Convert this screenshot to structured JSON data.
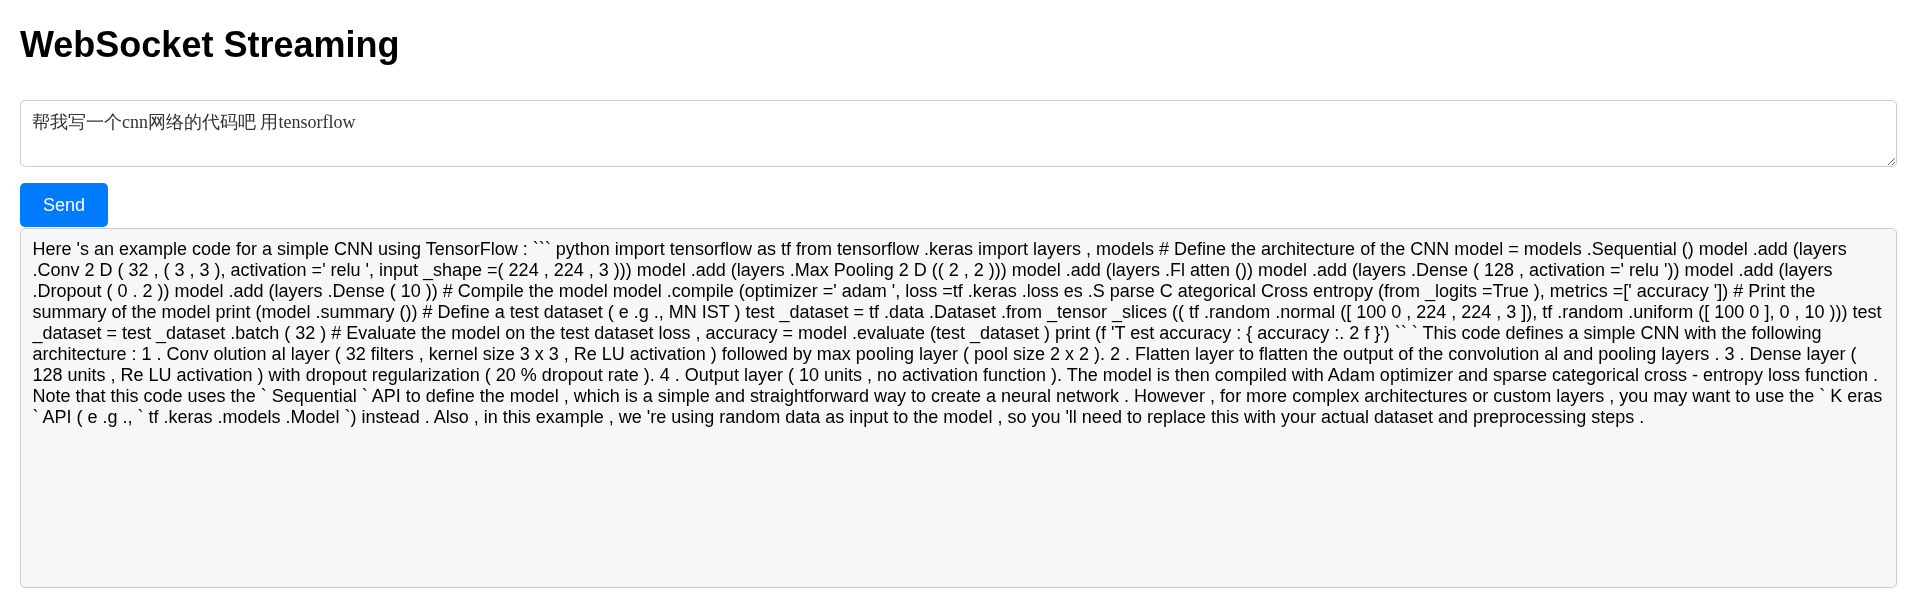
{
  "page": {
    "title": "WebSocket Streaming"
  },
  "message_input": {
    "value": "帮我写一个cnn网络的代码吧 用tensorflow"
  },
  "send_button": {
    "label": "Send"
  },
  "response": {
    "text": "Here 's an example code for a simple CNN using TensorFlow : ``` python import tensorflow as tf from tensorflow .keras import layers , models # Define the architecture of the CNN model = models .Sequential () model .add (layers .Conv 2 D ( 32 , ( 3 , 3 ), activation =' relu ', input _shape =( 224 , 224 , 3 ))) model .add (layers .Max Pooling 2 D (( 2 , 2 ))) model .add (layers .Fl atten ()) model .add (layers .Dense ( 128 , activation =' relu ')) model .add (layers .Dropout ( 0 . 2 )) model .add (layers .Dense ( 10 )) # Compile the model model .compile (optimizer =' adam ', loss =tf .keras .loss es .S parse C ategorical Cross entropy (from _logits =True ), metrics =[' accuracy ']) # Print the summary of the model print (model .summary ()) # Define a test dataset ( e .g ., MN IST ) test _dataset = tf .data .Dataset .from _tensor _slices (( tf .random .normal ([ 100 0 , 224 , 224 , 3 ]), tf .random .uniform ([ 100 0 ], 0 , 10 ))) test _dataset = test _dataset .batch ( 32 ) # Evaluate the model on the test dataset loss , accuracy = model .evaluate (test _dataset ) print (f 'T est accuracy : { accuracy :. 2 f }') `` ` This code defines a simple CNN with the following architecture : 1 . Conv olution al layer ( 32 filters , kernel size 3 x 3 , Re LU activation ) followed by max pooling layer ( pool size 2 x 2 ). 2 . Flatten layer to flatten the output of the convolution al and pooling layers . 3 . Dense layer ( 128 units , Re LU activation ) with dropout regularization ( 20 % dropout rate ). 4 . Output layer ( 10 units , no activation function ). The model is then compiled with Adam optimizer and sparse categorical cross - entropy loss function . Note that this code uses the ` Sequential ` API to define the model , which is a simple and straightforward way to create a neural network . However , for more complex architectures or custom layers , you may want to use the ` K eras ` API ( e .g ., ` tf .keras .models .Model `) instead . Also , in this example , we 're using random data as input to the model , so you 'll need to replace this with your actual dataset and preprocessing steps ."
  }
}
